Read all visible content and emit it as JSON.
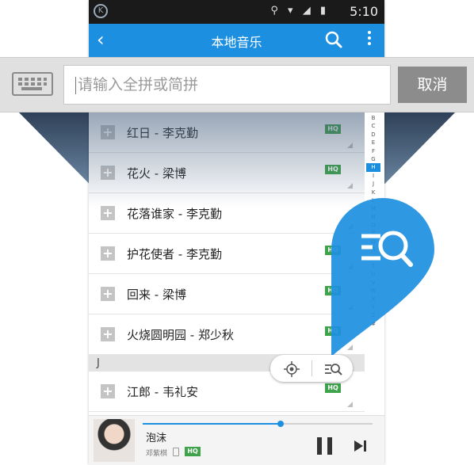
{
  "status_bar": {
    "app_icon": "K",
    "icons": "⚲ ▾ ◢ ▮",
    "time": "5:10"
  },
  "app_bar": {
    "back_icon": "‹",
    "title": "本地音乐"
  },
  "search": {
    "placeholder": "请输入全拼或简拼",
    "cancel_label": "取消"
  },
  "songs": [
    {
      "title": "红日 - 李克勤",
      "badge": "HQ"
    },
    {
      "title": "花火 - 梁博",
      "badge": "HQ"
    },
    {
      "title": "花落谁家 - 李克勤",
      "badge": ""
    },
    {
      "title": "护花使者 - 李克勤",
      "badge": "HQ"
    },
    {
      "title": "回来 - 梁博",
      "badge": "HQ"
    },
    {
      "title": "火烧圆明园 - 郑少秋",
      "badge": "HQ"
    }
  ],
  "section_j": {
    "letter": "J",
    "songs": [
      {
        "title": "江郎 - 韦礼安",
        "badge": "HQ"
      }
    ]
  },
  "plus_icon": "+",
  "index_letters": [
    "B",
    "C",
    "D",
    "E",
    "F",
    "G",
    "H",
    "I",
    "J",
    "K",
    "L",
    "M",
    "N",
    "O",
    "P",
    "Q",
    "R",
    "S",
    "T",
    "U",
    "V",
    "W",
    "X",
    "Y",
    "Z",
    "#"
  ],
  "index_active": "H",
  "player": {
    "title": "泡沫",
    "artist": "邓紫棋",
    "badge": "HQ",
    "progress": 0.6
  },
  "colors": {
    "accent": "#1d8fe1",
    "hq": "#3ea34a"
  }
}
